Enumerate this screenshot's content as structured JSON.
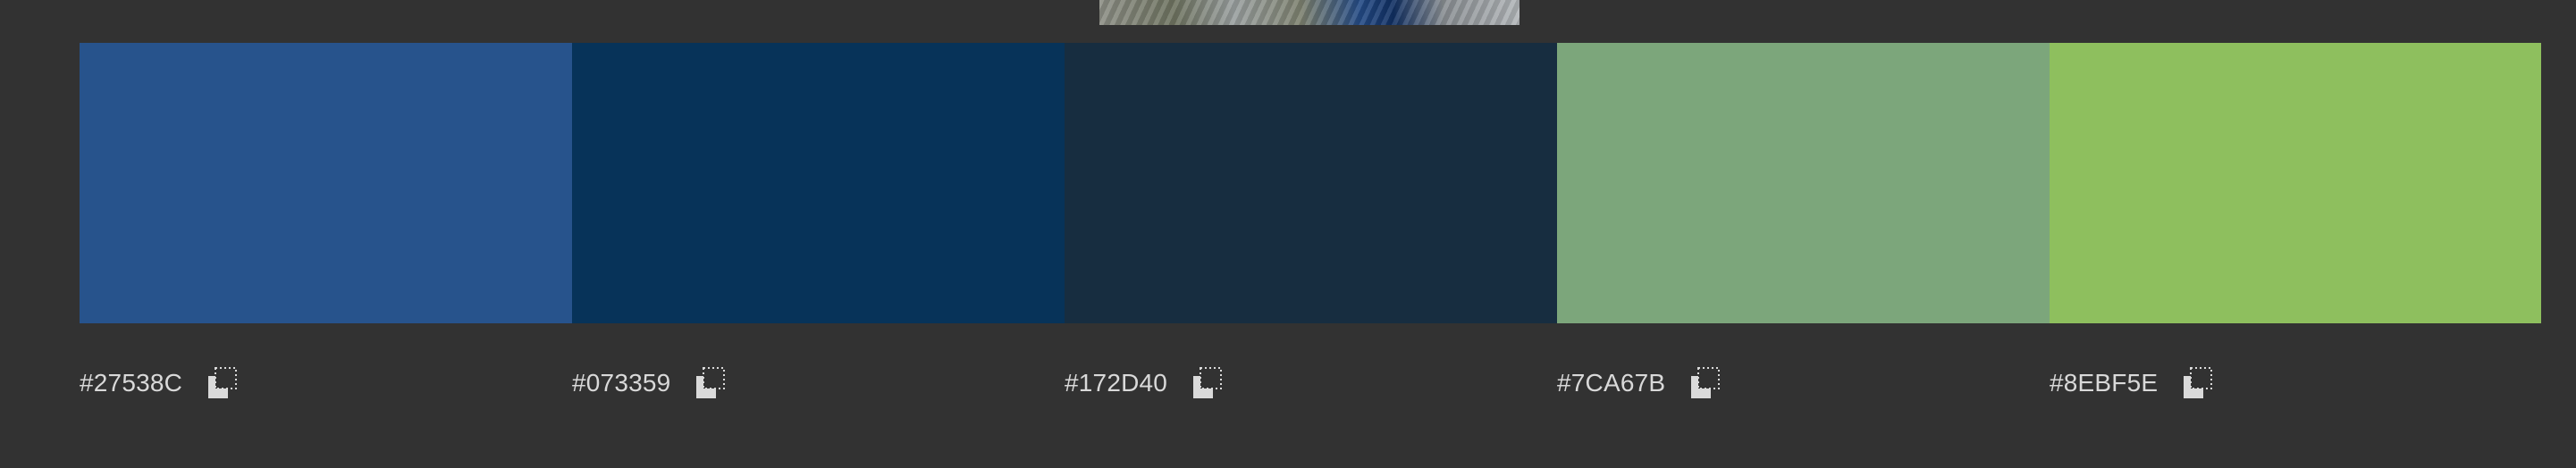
{
  "preview_image": {
    "description_icon": "source-image-thumbnail"
  },
  "palette": [
    {
      "hex": "#27538C",
      "color": "#27538C",
      "copy_icon": "copy-icon"
    },
    {
      "hex": "#073359",
      "color": "#073359",
      "copy_icon": "copy-icon"
    },
    {
      "hex": "#172D40",
      "color": "#172D40",
      "copy_icon": "copy-icon"
    },
    {
      "hex": "#7CA67B",
      "color": "#7CA67B",
      "copy_icon": "copy-icon"
    },
    {
      "hex": "#8EBF5E",
      "color": "#8EBF5E",
      "copy_icon": "copy-icon"
    }
  ],
  "theme": {
    "background": "#323232",
    "text": "#D9D9D9",
    "icon": "#DADADA"
  }
}
